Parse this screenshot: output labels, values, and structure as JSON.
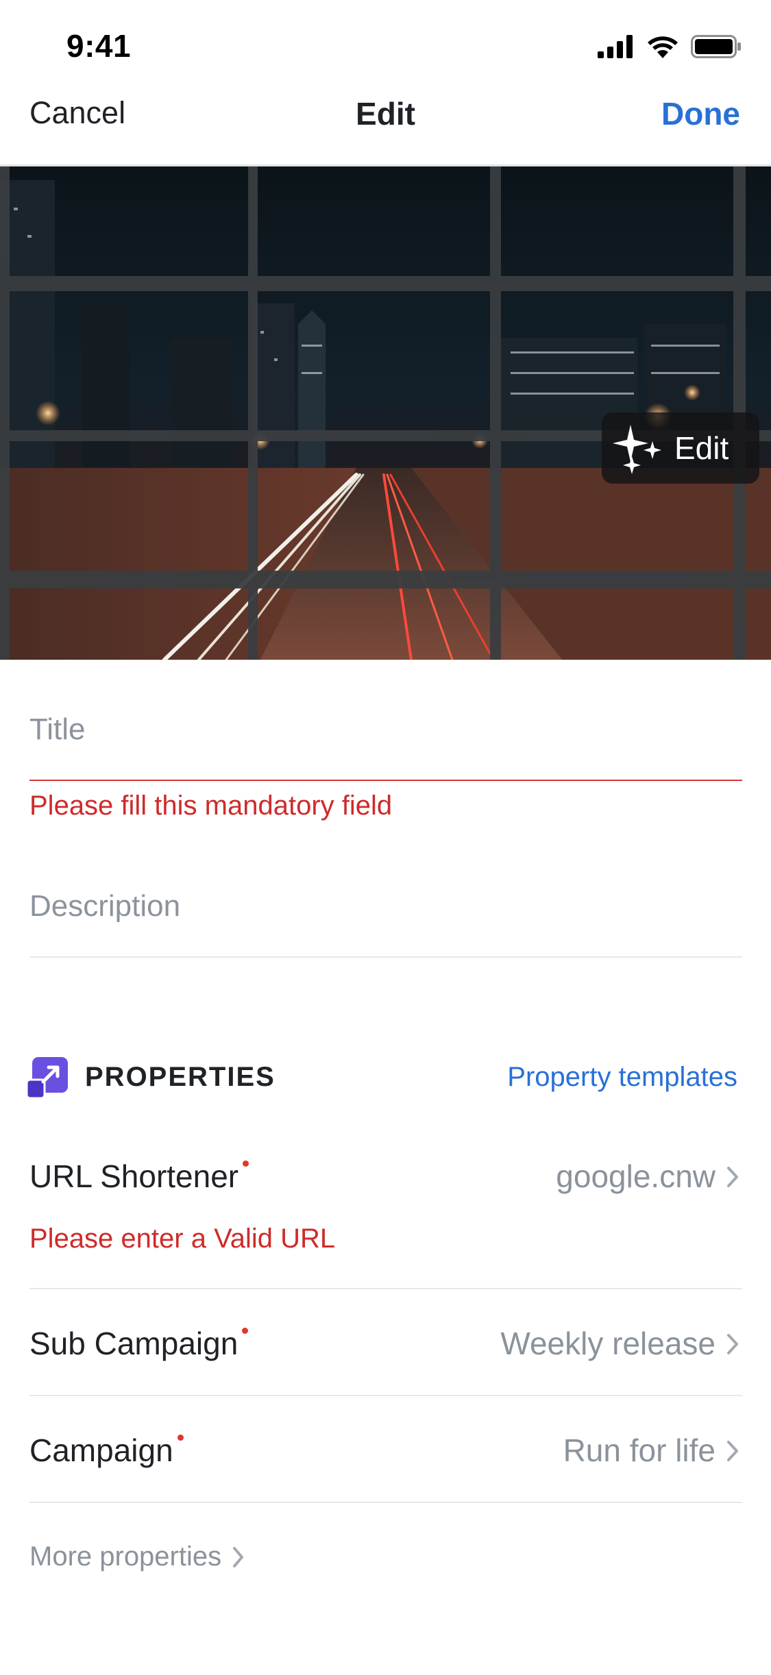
{
  "status_bar": {
    "time": "9:41"
  },
  "nav": {
    "cancel": "Cancel",
    "title": "Edit",
    "done": "Done"
  },
  "photo": {
    "edit_label": "Edit"
  },
  "form": {
    "title_placeholder": "Title",
    "title_error": "Please fill this mandatory field",
    "description_placeholder": "Description"
  },
  "properties": {
    "heading": "PROPERTIES",
    "templates_link": "Property templates",
    "rows": [
      {
        "label": "URL Shortener",
        "value": "google.cnw",
        "error": "Please enter a Valid URL"
      },
      {
        "label": "Sub Campaign",
        "value": "Weekly release"
      },
      {
        "label": "Campaign",
        "value": "Run for life"
      }
    ],
    "more": "More properties"
  },
  "colors": {
    "accent": "#2870d8",
    "error": "#cf2a2a",
    "required_dot": "#e0362c",
    "properties_icon": "#6b4fe0"
  }
}
